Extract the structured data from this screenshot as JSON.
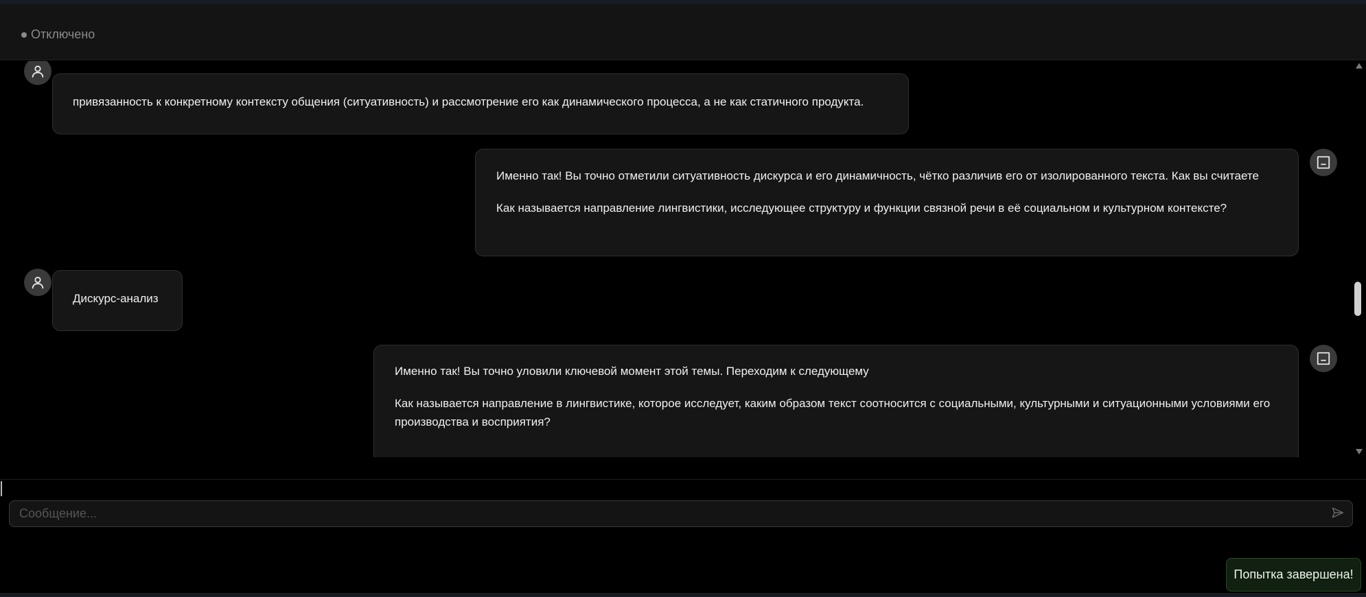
{
  "header": {
    "status_text": "Отключено"
  },
  "messages": [
    {
      "role": "user",
      "paragraphs": [
        "привязанность к конкретному контексту общения (ситуативность) и рассмотрение его как динамического процесса, а не как статичного продукта."
      ]
    },
    {
      "role": "bot",
      "paragraphs": [
        "Именно так! Вы точно отметили ситуативность дискурса и его динамичность, чётко различив его от изолированного текста. Как вы считаете",
        "Как называется направление лингвистики, исследующее структуру и функции связной речи в её социальном и культурном контексте?"
      ]
    },
    {
      "role": "user",
      "paragraphs": [
        "Дискурс-анализ"
      ]
    },
    {
      "role": "bot",
      "paragraphs": [
        "Именно так! Вы точно уловили ключевой момент этой темы. Переходим к следующему",
        "Как называется направление в лингвистике, которое исследует, каким образом текст соотносится с социальными, культурными и ситуационными условиями его производства и восприятия?"
      ]
    }
  ],
  "composer": {
    "placeholder": "Сообщение...",
    "value": ""
  },
  "toast": {
    "text": "Попытка завершена!"
  },
  "icons": {
    "user_avatar": "user-icon",
    "bot_avatar": "bot-icon",
    "send": "send-icon"
  },
  "colors": {
    "background": "#000000",
    "bubble": "#161616",
    "toast_bg": "#112011",
    "toast_border": "#274a27"
  }
}
